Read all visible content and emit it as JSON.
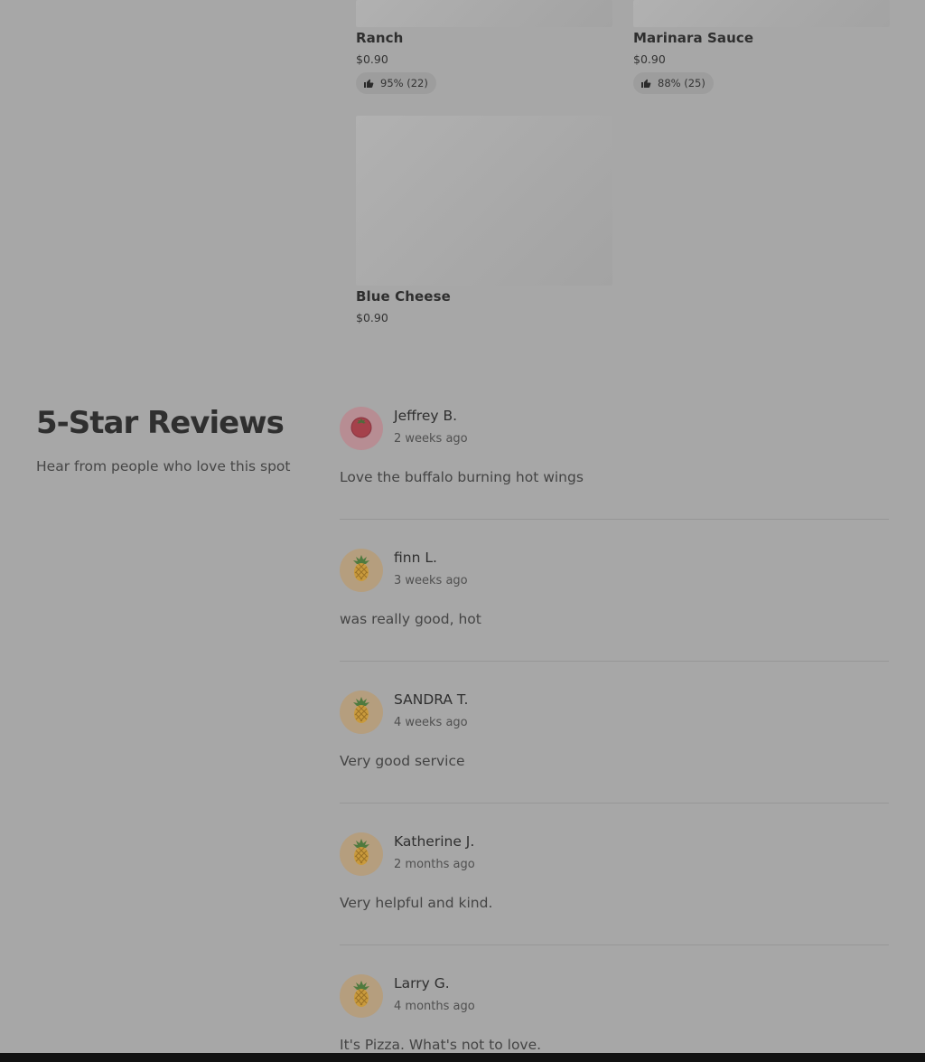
{
  "menu_items": [
    {
      "name": "Ranch",
      "price": "$0.90",
      "rating": "95% (22)"
    },
    {
      "name": "Marinara Sauce",
      "price": "$0.90",
      "rating": "88% (25)"
    },
    {
      "name": "Blue Cheese",
      "price": "$0.90"
    }
  ],
  "reviews_section": {
    "title": "5-Star Reviews",
    "subtitle": "Hear from people who love this spot"
  },
  "reviews": [
    {
      "name": "Jeffrey B.",
      "time": "2 weeks ago",
      "text": "Love the buffalo burning hot wings",
      "avatar_icon": "tomato-icon"
    },
    {
      "name": "finn L.",
      "time": "3 weeks ago",
      "text": "was really good, hot",
      "avatar_icon": "pineapple-icon"
    },
    {
      "name": "SANDRA T.",
      "time": "4 weeks ago",
      "text": "Very good service",
      "avatar_icon": "pineapple-icon"
    },
    {
      "name": "Katherine J.",
      "time": "2 months ago",
      "text": "Very helpful and kind.",
      "avatar_icon": "pineapple-icon"
    },
    {
      "name": "Larry G.",
      "time": "4 months ago",
      "text": "It's Pizza. What's not to love.",
      "avatar_icon": "pineapple-icon"
    }
  ],
  "colors": {
    "page_background": "#a7a7a7",
    "rating_pill": "#9d9d9d",
    "avatar_pineapple_bg": "#b59e7e",
    "avatar_tomato_bg": "#b78d93"
  }
}
